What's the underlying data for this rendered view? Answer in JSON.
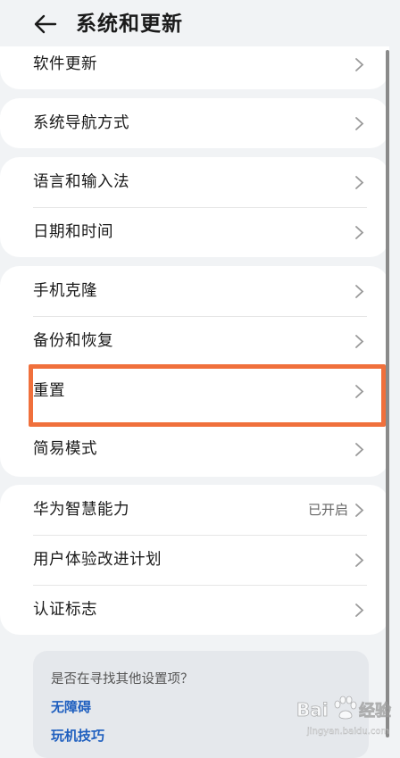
{
  "header": {
    "title": "系统和更新",
    "back_icon": "back-arrow-icon"
  },
  "groups": [
    {
      "items": [
        {
          "label": "软件更新"
        }
      ]
    },
    {
      "items": [
        {
          "label": "系统导航方式"
        }
      ]
    },
    {
      "items": [
        {
          "label": "语言和输入法"
        },
        {
          "label": "日期和时间"
        }
      ]
    },
    {
      "items": [
        {
          "label": "手机克隆"
        },
        {
          "label": "备份和恢复"
        },
        {
          "label": "重置",
          "highlighted": true
        },
        {
          "label": "简易模式"
        }
      ]
    },
    {
      "items": [
        {
          "label": "华为智慧能力",
          "value": "已开启"
        },
        {
          "label": "用户体验改进计划"
        },
        {
          "label": "认证标志"
        }
      ]
    }
  ],
  "suggestions": {
    "title": "是否在寻找其他设置项？",
    "links": [
      "无障碍",
      "玩机技巧"
    ]
  },
  "colors": {
    "background": "#f1f3f5",
    "card": "#ffffff",
    "highlight": "#f0703c",
    "link": "#1f5fbf"
  },
  "watermark": {
    "text": "Bai经验",
    "subtext": "jingyan.baidu.com"
  }
}
